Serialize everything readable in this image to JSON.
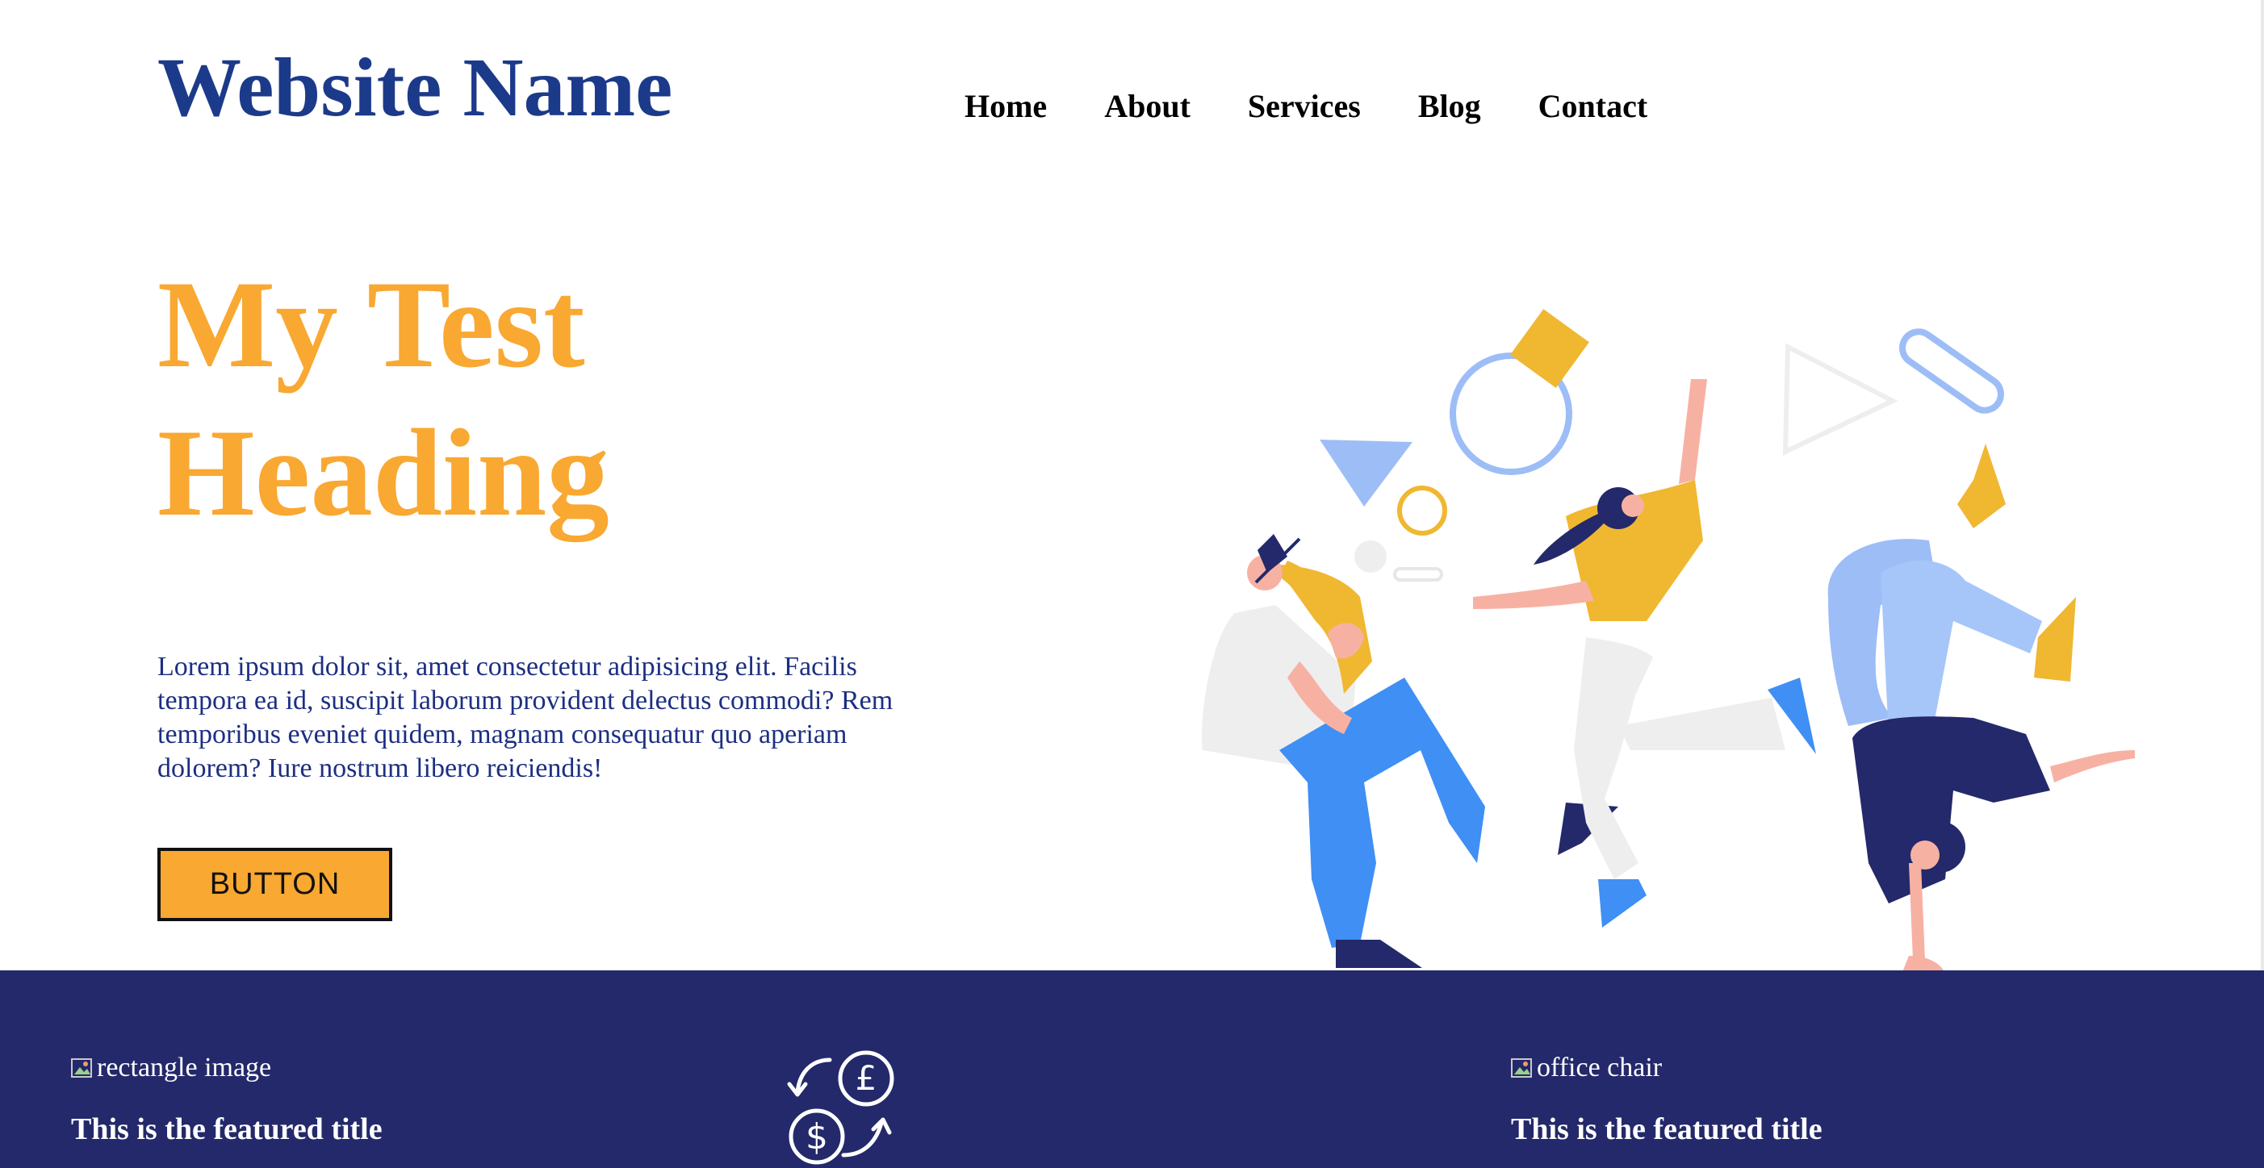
{
  "header": {
    "site_name": "Website Name",
    "nav": [
      "Home",
      "About",
      "Services",
      "Blog",
      "Contact"
    ]
  },
  "hero": {
    "heading_line1": "My Test",
    "heading_line2": "Heading",
    "body": "Lorem ipsum dolor sit, amet consectetur adipisicing elit. Facilis tempora ea id, suscipit laborum provident delectus commodi? Rem temporibus eveniet quidem, magnam consequatur quo aperiam dolorem? Iure nostrum libero reiciendis!",
    "button_label": "BUTTON",
    "illustration_icon": "dancing-people-illustration"
  },
  "featured": [
    {
      "image_alt": "rectangle image",
      "title": "This is the featured title",
      "icon": "broken-image-icon"
    },
    {
      "icon": "currency-exchange-icon"
    },
    {
      "image_alt": "office chair",
      "title": "This is the featured title",
      "icon": "broken-image-icon"
    }
  ],
  "colors": {
    "brand_blue": "#1c3a8a",
    "accent_orange": "#f9a832",
    "band_navy": "#23296a",
    "body_text": "#1c2f82"
  }
}
